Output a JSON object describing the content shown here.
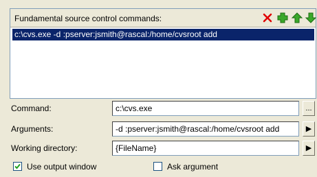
{
  "panel": {
    "title": "Fundamental source control commands:",
    "tools": [
      {
        "icon": "delete-icon",
        "color": "#e00000"
      },
      {
        "icon": "add-icon",
        "color": "#2e9a1e"
      },
      {
        "icon": "move-up-icon",
        "color": "#2e9a1e"
      },
      {
        "icon": "move-down-icon",
        "color": "#2e9a1e"
      }
    ],
    "items": [
      "c:\\cvs.exe -d :pserver:jsmith@rascal:/home/cvsroot add"
    ]
  },
  "form": {
    "command_label": "Command:",
    "command_value": "c:\\cvs.exe",
    "command_button": "...",
    "arguments_label": "Arguments:",
    "arguments_value": "-d :pserver:jsmith@rascal:/home/cvsroot add",
    "arguments_button": "▶",
    "workdir_label": "Working directory:",
    "workdir_value": "{FileName}",
    "workdir_button": "▶"
  },
  "options": {
    "use_output_label": "Use output window",
    "use_output_checked": true,
    "ask_argument_label": "Ask argument",
    "ask_argument_checked": false
  },
  "colors": {
    "selection": "#0a246a",
    "window": "#ece9d8"
  }
}
